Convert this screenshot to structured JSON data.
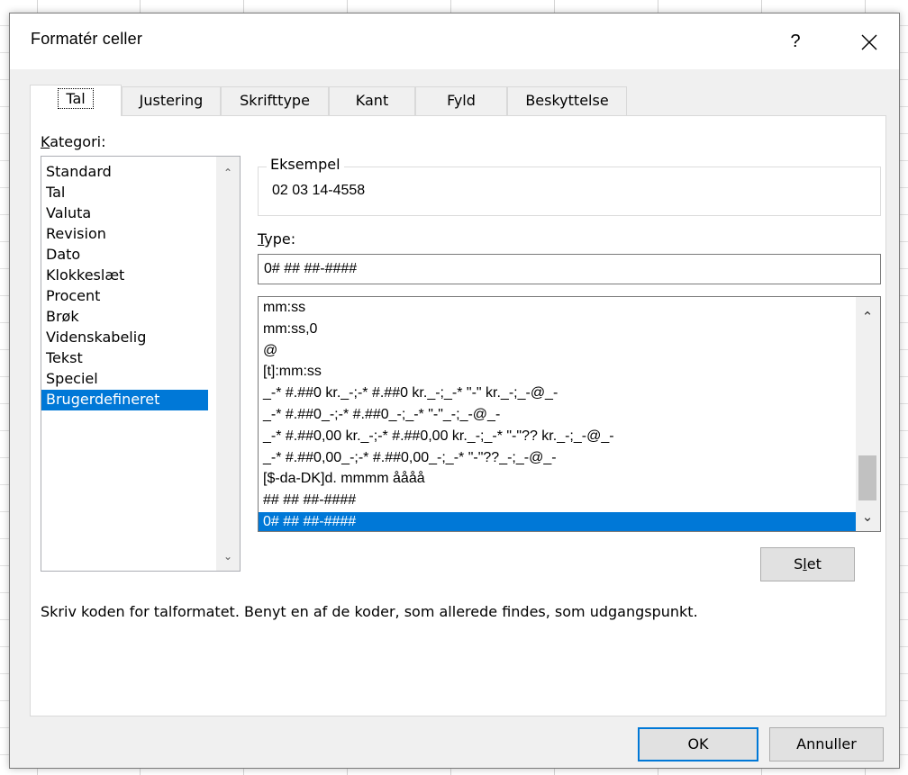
{
  "dialog": {
    "title": "Formatér celler",
    "help_label": "?",
    "close_label": "✕"
  },
  "tabs": [
    {
      "label": "Tal",
      "active": true
    },
    {
      "label": "Justering"
    },
    {
      "label": "Skrifttype"
    },
    {
      "label": "Kant"
    },
    {
      "label": "Fyld"
    },
    {
      "label": "Beskyttelse"
    }
  ],
  "category": {
    "label_first": "K",
    "label_rest": "ategori:",
    "items": [
      "Standard",
      "Tal",
      "Valuta",
      "Revision",
      "Dato",
      "Klokkeslæt",
      "Procent",
      "Brøk",
      "Videnskabelig",
      "Tekst",
      "Speciel",
      "Brugerdefineret"
    ],
    "selected": "Brugerdefineret"
  },
  "sample": {
    "label": "Eksempel",
    "value": "02 03 14-4558"
  },
  "type": {
    "label_first": "T",
    "label_rest": "ype:",
    "value": "0# ## ##-####"
  },
  "formats": {
    "items": [
      "mm:ss",
      "mm:ss,0",
      "@",
      "[t]:mm:ss",
      "_-* #.##0 kr._-;-* #.##0 kr._-;_-* \"-\" kr._-;_-@_-",
      "_-* #.##0_-;-* #.##0_-;_-* \"-\"_-;_-@_-",
      "_-* #.##0,00 kr._-;-* #.##0,00 kr._-;_-* \"-\"?? kr._-;_-@_-",
      "_-* #.##0,00_-;-* #.##0,00_-;_-* \"-\"??_-;_-@_-",
      "[$-da-DK]d. mmmm åååå",
      "## ## ##-####",
      "0# ## ##-####"
    ],
    "selected": "0# ## ##-####"
  },
  "delete_button": {
    "first": "S",
    "underlined": "l",
    "rest": "et"
  },
  "hint": "Skriv koden for talformatet. Benyt en af de koder, som allerede findes, som udgangspunkt.",
  "ok_label": "OK",
  "cancel_label": "Annuller"
}
